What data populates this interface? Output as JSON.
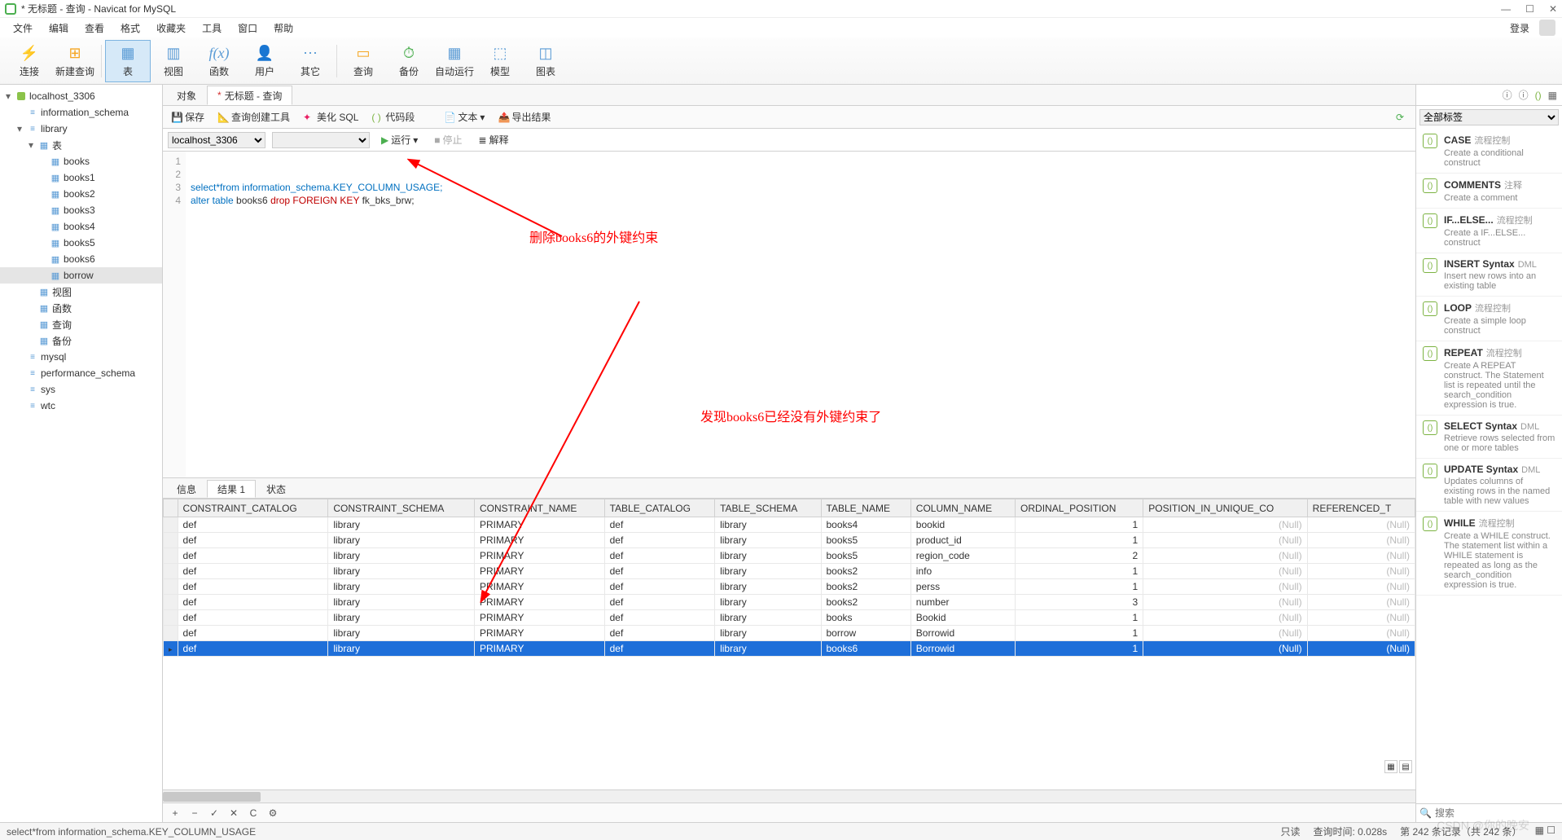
{
  "title": "* 无标题 - 查询 - Navicat for MySQL",
  "menu": [
    "文件",
    "编辑",
    "查看",
    "格式",
    "收藏夹",
    "工具",
    "窗口",
    "帮助"
  ],
  "login": "登录",
  "toolbar": [
    {
      "label": "连接",
      "color": "#4caf50",
      "glyph": "⚡"
    },
    {
      "label": "新建查询",
      "color": "#f5a623",
      "glyph": "⊞"
    },
    {
      "label": "表",
      "color": "#5a9bd5",
      "glyph": "▦",
      "active": true
    },
    {
      "label": "视图",
      "color": "#5a9bd5",
      "glyph": "▥"
    },
    {
      "label": "函数",
      "color": "#5a9bd5",
      "glyph": "f(x)",
      "fx": true
    },
    {
      "label": "用户",
      "color": "#5a9bd5",
      "glyph": "👤"
    },
    {
      "label": "其它",
      "color": "#5a9bd5",
      "glyph": "⋯"
    },
    {
      "label": "查询",
      "color": "#f5a623",
      "glyph": "▭"
    },
    {
      "label": "备份",
      "color": "#4caf50",
      "glyph": "⏱"
    },
    {
      "label": "自动运行",
      "color": "#5a9bd5",
      "glyph": "▦"
    },
    {
      "label": "模型",
      "color": "#5a9bd5",
      "glyph": "⬚"
    },
    {
      "label": "图表",
      "color": "#5a9bd5",
      "glyph": "◫"
    }
  ],
  "tree": {
    "server": "localhost_3306",
    "dbs": [
      {
        "name": "information_schema",
        "open": false
      },
      {
        "name": "library",
        "open": true,
        "children": [
          {
            "name": "表",
            "open": true,
            "icon": "tbl",
            "items": [
              "books",
              "books1",
              "books2",
              "books3",
              "books4",
              "books5",
              "books6",
              "borrow"
            ],
            "sel": "borrow"
          },
          {
            "name": "视图",
            "icon": "tbl"
          },
          {
            "name": "函数",
            "icon": "fx"
          },
          {
            "name": "查询",
            "icon": "q"
          },
          {
            "name": "备份",
            "icon": "bk"
          }
        ]
      },
      {
        "name": "mysql"
      },
      {
        "name": "performance_schema"
      },
      {
        "name": "sys"
      },
      {
        "name": "wtc"
      }
    ]
  },
  "tabs": [
    {
      "label": "对象",
      "active": false
    },
    {
      "label": "无标题 - 查询",
      "dirty": "*",
      "active": true
    }
  ],
  "qbar": {
    "save": "保存",
    "builder": "查询创建工具",
    "beauty": "美化 SQL",
    "codegen": "代码段",
    "text": "文本",
    "export": "导出结果"
  },
  "qrun": {
    "conn": "localhost_3306",
    "db": "",
    "run": "运行",
    "stop": "停止",
    "explain": "解释"
  },
  "sql": {
    "l3": "select*from information_schema.KEY_COLUMN_USAGE;",
    "l4a": "alter table",
    "l4b": " books6 ",
    "l4c": "drop FOREIGN KEY",
    "l4d": " fk_bks_brw;"
  },
  "annot1": "删除books6的外键约束",
  "annot2": "发现books6已经没有外键约束了",
  "rtabs": [
    "信息",
    "结果 1",
    "状态"
  ],
  "rtab_active": 1,
  "cols": [
    "CONSTRAINT_CATALOG",
    "CONSTRAINT_SCHEMA",
    "CONSTRAINT_NAME",
    "TABLE_CATALOG",
    "TABLE_SCHEMA",
    "TABLE_NAME",
    "COLUMN_NAME",
    "ORDINAL_POSITION",
    "POSITION_IN_UNIQUE_CO",
    "REFERENCED_T"
  ],
  "rows": [
    [
      "def",
      "library",
      "PRIMARY",
      "def",
      "library",
      "books4",
      "bookid",
      "1",
      "(Null)",
      "(Null)"
    ],
    [
      "def",
      "library",
      "PRIMARY",
      "def",
      "library",
      "books5",
      "product_id",
      "1",
      "(Null)",
      "(Null)"
    ],
    [
      "def",
      "library",
      "PRIMARY",
      "def",
      "library",
      "books5",
      "region_code",
      "2",
      "(Null)",
      "(Null)"
    ],
    [
      "def",
      "library",
      "PRIMARY",
      "def",
      "library",
      "books2",
      "info",
      "1",
      "(Null)",
      "(Null)"
    ],
    [
      "def",
      "library",
      "PRIMARY",
      "def",
      "library",
      "books2",
      "perss",
      "1",
      "(Null)",
      "(Null)"
    ],
    [
      "def",
      "library",
      "PRIMARY",
      "def",
      "library",
      "books2",
      "number",
      "3",
      "(Null)",
      "(Null)"
    ],
    [
      "def",
      "library",
      "PRIMARY",
      "def",
      "library",
      "books",
      "Bookid",
      "1",
      "(Null)",
      "(Null)"
    ],
    [
      "def",
      "library",
      "PRIMARY",
      "def",
      "library",
      "borrow",
      "Borrowid",
      "1",
      "(Null)",
      "(Null)"
    ],
    [
      "def",
      "library",
      "PRIMARY",
      "def",
      "library",
      "books6",
      "Borrowid",
      "1",
      "(Null)",
      "(Null)"
    ]
  ],
  "selrow": 8,
  "status": {
    "sql": "select*from information_schema.KEY_COLUMN_USAGE",
    "ro": "只读",
    "time": "查询时间: 0.028s",
    "rec": "第 242 条记录（共 242 条）"
  },
  "rpanel_filter": "全部标签",
  "snips": [
    {
      "t": "CASE",
      "c": "流程控制",
      "d": "Create a conditional construct"
    },
    {
      "t": "COMMENTS",
      "c": "注释",
      "d": "Create a comment"
    },
    {
      "t": "IF...ELSE...",
      "c": "流程控制",
      "d": "Create a IF...ELSE... construct"
    },
    {
      "t": "INSERT Syntax",
      "c": "DML",
      "d": "Insert new rows into an existing table"
    },
    {
      "t": "LOOP",
      "c": "流程控制",
      "d": "Create a simple loop construct"
    },
    {
      "t": "REPEAT",
      "c": "流程控制",
      "d": "Create A REPEAT construct. The Statement list is repeated until the search_condition expression is true."
    },
    {
      "t": "SELECT Syntax",
      "c": "DML",
      "d": "Retrieve rows selected from one or more tables"
    },
    {
      "t": "UPDATE Syntax",
      "c": "DML",
      "d": "Updates columns of existing rows in the named table with new values"
    },
    {
      "t": "WHILE",
      "c": "流程控制",
      "d": "Create a WHILE construct. The statement list within a WHILE statement is repeated as long as the search_condition expression is true."
    }
  ],
  "search_ph": "搜索",
  "watermark": "CSDN @你的晚安"
}
